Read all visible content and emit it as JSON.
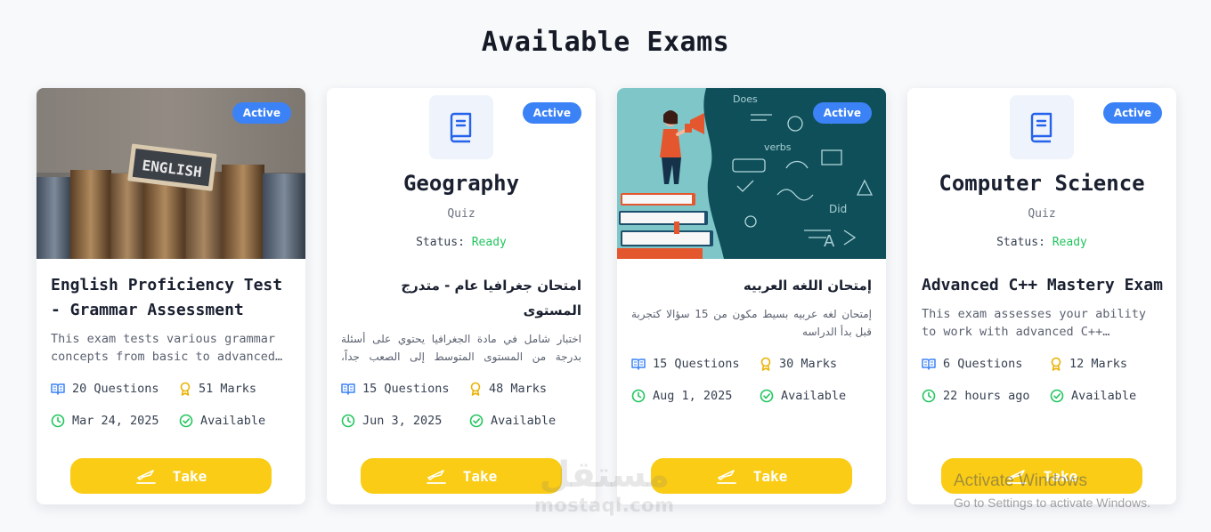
{
  "page": {
    "title": "Available Exams"
  },
  "colors": {
    "accent": "#3b82f6",
    "button": "#facc15",
    "success": "#22c55e",
    "marks": "#eab308"
  },
  "cards": [
    {
      "badge": "Active",
      "media": "english-books-photo",
      "title": "English Proficiency Test - Grammar Assessment",
      "description": "This exam tests various grammar concepts from basic to advanced…",
      "questions": "20 Questions",
      "marks": "51 Marks",
      "date": "Mar 24, 2025",
      "availability": "Available",
      "button": "Take"
    },
    {
      "badge": "Active",
      "media": "book-icon",
      "subject": "Geography",
      "kind": "Quiz",
      "status_label": "Status:",
      "status_value": "Ready",
      "title": "امتحان جغرافيا عام - متدرج المستوى",
      "description": "اختبار شامل في مادة الجغرافيا يحتوي على أسئلة بدرجة من المستوى المتوسط إلى الصعب جداً، يهدف...",
      "questions": "15 Questions",
      "marks": "48 Marks",
      "date": "Jun 3, 2025",
      "availability": "Available",
      "button": "Take"
    },
    {
      "badge": "Active",
      "media": "language-illustration",
      "title": "إمتحان اللغه العربيه",
      "description": "إمتحان لغه عربيه بسيط مكون من 15 سؤالا كتجربة قبل بدأ الدراسه",
      "questions": "15 Questions",
      "marks": "30 Marks",
      "date": "Aug 1, 2025",
      "availability": "Available",
      "button": "Take"
    },
    {
      "badge": "Active",
      "media": "book-icon",
      "subject": "Computer Science",
      "kind": "Quiz",
      "status_label": "Status:",
      "status_value": "Ready",
      "title": "Advanced C++ Mastery Exam",
      "description": "This exam assesses your ability to work with advanced C++…",
      "questions": "6 Questions",
      "marks": "12 Marks",
      "date": "22 hours ago",
      "availability": "Available",
      "button": "Take"
    }
  ],
  "watermark": {
    "arabic": "مستقل",
    "latin": "mostaql.com"
  },
  "windows_notice": {
    "line1": "Activate Windows",
    "line2": "Go to Settings to activate Windows."
  }
}
